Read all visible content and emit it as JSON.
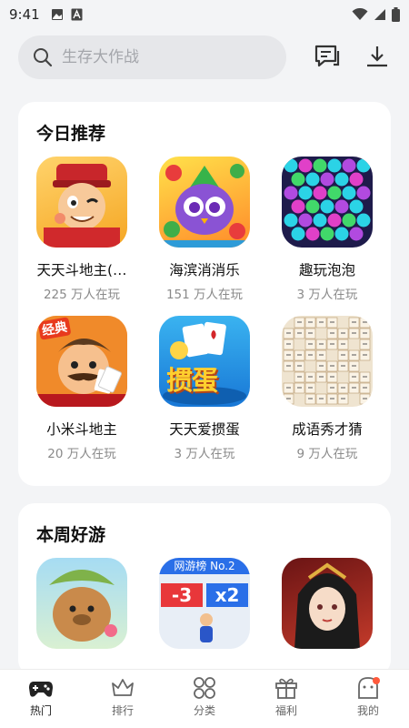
{
  "status": {
    "time": "9:41"
  },
  "search": {
    "placeholder": "生存大作战"
  },
  "sections": [
    {
      "title": "今日推荐",
      "games": [
        {
          "name": "天天斗地主(…",
          "players": "225 万人在玩",
          "icon": "landlord-cartoon-icon"
        },
        {
          "name": "海滨消消乐",
          "players": "151 万人在玩",
          "icon": "owl-match-icon"
        },
        {
          "name": "趣玩泡泡",
          "players": "3 万人在玩",
          "icon": "bubble-shooter-icon"
        },
        {
          "name": "小米斗地主",
          "players": "20 万人在玩",
          "icon": "classic-landlord-icon",
          "badge": "经典"
        },
        {
          "name": "天天爱掼蛋",
          "players": "3 万人在玩",
          "icon": "guandan-cards-icon",
          "logo_text": "掼蛋"
        },
        {
          "name": "成语秀才猜",
          "players": "9 万人在玩",
          "icon": "idiom-crossword-icon"
        }
      ]
    },
    {
      "title": "本周好游",
      "games": [
        {
          "icon": "capybara-icon"
        },
        {
          "icon": "runner-numbers-icon",
          "banner": "网游榜 No.2",
          "tiles": [
            "-3",
            "x2"
          ]
        },
        {
          "icon": "anime-character-icon"
        }
      ]
    }
  ],
  "tabs": [
    {
      "label": "热门",
      "icon": "gamepad-icon",
      "active": true
    },
    {
      "label": "排行",
      "icon": "crown-icon"
    },
    {
      "label": "分类",
      "icon": "category-grid-icon"
    },
    {
      "label": "福利",
      "icon": "gift-icon"
    },
    {
      "label": "我的",
      "icon": "profile-icon",
      "badge": true
    }
  ],
  "colors": {
    "accent_badge": "#ff5a3c",
    "background": "#f3f4f6",
    "card": "#ffffff"
  }
}
